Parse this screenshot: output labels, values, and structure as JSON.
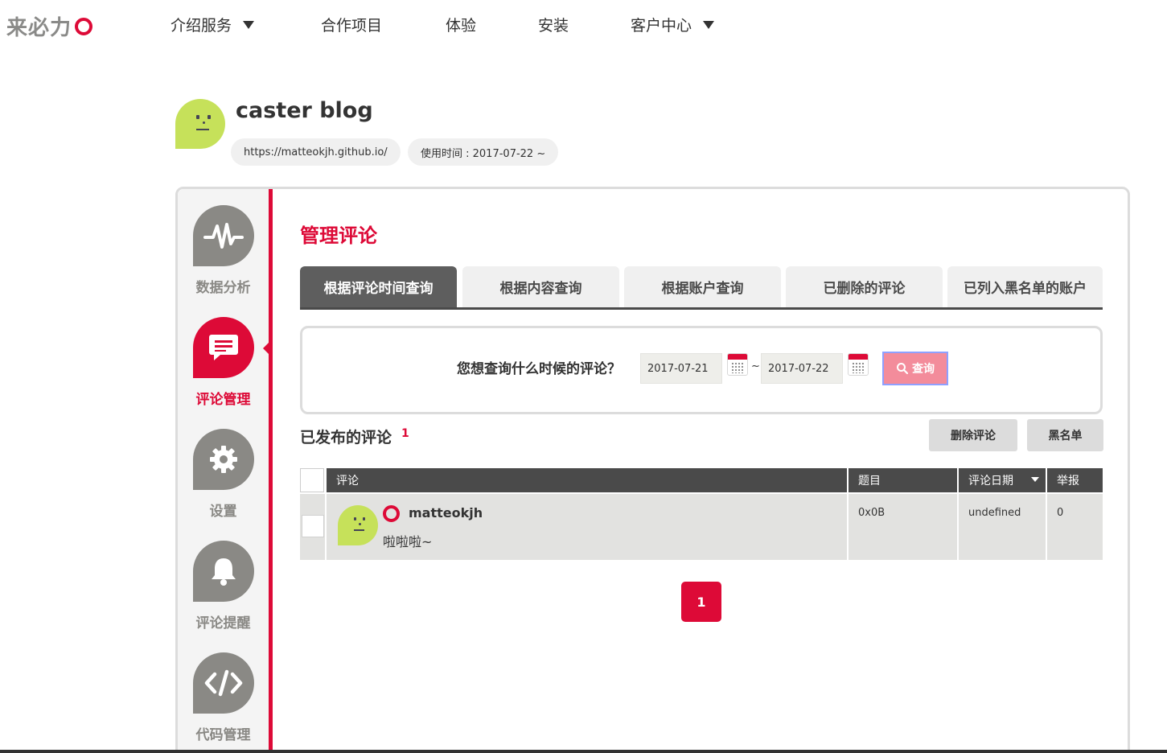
{
  "logo": {
    "text": "来必力"
  },
  "nav": [
    {
      "label": "介绍服务",
      "has_dropdown": true
    },
    {
      "label": "合作项目",
      "has_dropdown": false
    },
    {
      "label": "体验",
      "has_dropdown": false
    },
    {
      "label": "安装",
      "has_dropdown": false
    },
    {
      "label": "客户中心",
      "has_dropdown": true
    }
  ],
  "blog": {
    "title": "caster blog",
    "url": "https://matteokjh.github.io/",
    "usage": "使用时间 : 2017-07-22 ~"
  },
  "sidebar": {
    "items": [
      {
        "label": "数据分析",
        "icon": "activity-icon",
        "active": false
      },
      {
        "label": "评论管理",
        "icon": "comment-icon",
        "active": true
      },
      {
        "label": "设置",
        "icon": "gear-icon",
        "active": false
      },
      {
        "label": "评论提醒",
        "icon": "bell-icon",
        "active": false
      },
      {
        "label": "代码管理",
        "icon": "code-icon",
        "active": false
      }
    ]
  },
  "main": {
    "title": "管理评论",
    "tabs": [
      {
        "label": "根据评论时间查询",
        "active": true
      },
      {
        "label": "根据内容查询",
        "active": false
      },
      {
        "label": "根据账户查询",
        "active": false
      },
      {
        "label": "已删除的评论",
        "active": false
      },
      {
        "label": "已列入黑名单的账户",
        "active": false
      }
    ],
    "query": {
      "label": "您想查询什么时候的评论？",
      "start_date": "2017-07-21",
      "end_date": "2017-07-22",
      "separator": "~",
      "button_label": "查询"
    },
    "published": {
      "label": "已发布的评论",
      "count": "1"
    },
    "actions": {
      "delete_label": "删除评论",
      "blacklist_label": "黑名单"
    },
    "table": {
      "headers": {
        "comment": "评论",
        "subject": "题目",
        "date": "评论日期",
        "report": "举报"
      },
      "rows": [
        {
          "user": "matteokjh",
          "text": "啦啦啦~",
          "subject": "0x0B",
          "date": "undefined",
          "report": "0"
        }
      ]
    },
    "pagination": {
      "current": "1"
    }
  },
  "colors": {
    "brand": "#dd0a37",
    "sidebar_icon": "#8a8985",
    "avatar": "#c6e15a",
    "table_header": "#4a4a4a"
  }
}
